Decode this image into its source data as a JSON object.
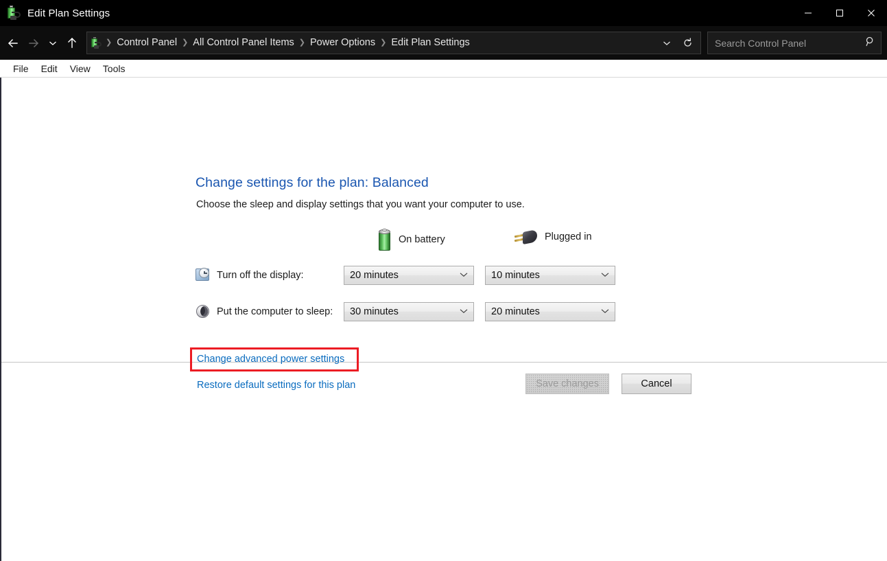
{
  "window": {
    "title": "Edit Plan Settings",
    "icon": "battery-plug-icon",
    "controls": {
      "minimize": "—",
      "maximize": "❐",
      "close": "✕"
    }
  },
  "navbar": {
    "back": "←",
    "forward": "→",
    "recent": "⌄",
    "up": "↑",
    "breadcrumb_icon": "power-options-icon",
    "crumbs": [
      "Control Panel",
      "All Control Panel Items",
      "Power Options",
      "Edit Plan Settings"
    ],
    "separator": "❯",
    "history_caret": "⌄",
    "refresh": "↻",
    "search": {
      "placeholder": "Search Control Panel",
      "value": "",
      "icon": "search-icon"
    }
  },
  "menubar": {
    "items": [
      "File",
      "Edit",
      "View",
      "Tools"
    ]
  },
  "main": {
    "heading": "Change settings for the plan: Balanced",
    "subheading": "Choose the sleep and display settings that you want your computer to use.",
    "columns": [
      {
        "id": "on-battery",
        "label": "On battery",
        "icon": "battery-icon"
      },
      {
        "id": "plugged-in",
        "label": "Plugged in",
        "icon": "power-plug-icon"
      }
    ],
    "settings": [
      {
        "id": "turn-off-display",
        "label": "Turn off the display:",
        "icon": "display-clock-icon",
        "on_battery": "20 minutes",
        "plugged_in": "10 minutes"
      },
      {
        "id": "put-computer-to-sleep",
        "label": "Put the computer to sleep:",
        "icon": "sleep-moon-icon",
        "on_battery": "30 minutes",
        "plugged_in": "20 minutes"
      }
    ],
    "dropdown_caret": "⌄",
    "links": [
      {
        "id": "change-advanced-power-settings",
        "label": "Change advanced power settings",
        "highlighted": true
      },
      {
        "id": "restore-default-settings",
        "label": "Restore default settings for this plan",
        "highlighted": false
      }
    ],
    "highlight_color": "#ec1c24",
    "link_color": "#0a6cbf",
    "heading_color": "#1a56b0"
  },
  "footer": {
    "save_label": "Save changes",
    "save_disabled": true,
    "cancel_label": "Cancel"
  }
}
